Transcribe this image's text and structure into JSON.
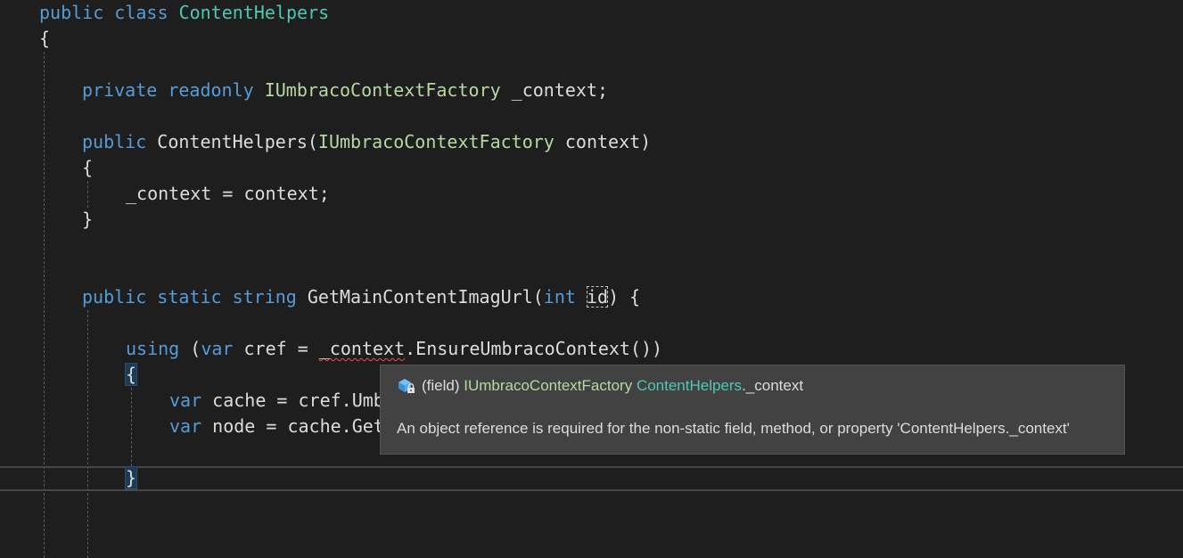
{
  "code": {
    "line1": {
      "kw1": "public",
      "kw2": "class",
      "type": "ContentHelpers"
    },
    "line2": {
      "brace": "{"
    },
    "line3": {
      "kw1": "private",
      "kw2": "readonly",
      "iface": "IUmbracoContextFactory",
      "rest": "_context;"
    },
    "line4": {
      "kw1": "public",
      "name": "ContentHelpers(",
      "iface": "IUmbracoContextFactory",
      "rest": "context)"
    },
    "line5": {
      "brace": "{"
    },
    "line6": {
      "text": "_context = context;"
    },
    "line7": {
      "brace": "}"
    },
    "line8": {
      "kw1": "public",
      "kw2": "static",
      "kw3": "string",
      "name": "GetMainContentImagUrl(",
      "kw4": "int",
      "param": "id",
      "rest": ") {"
    },
    "line9": {
      "kw1": "using",
      "open": "(",
      "kw2": "var",
      "mid": "cref =",
      "err": "_context",
      "rest": ".EnsureUmbracoContext())"
    },
    "line10": {
      "brace": "{"
    },
    "line11": {
      "kw": "var",
      "rest": "cache = cref.Umb"
    },
    "line12": {
      "kw": "var",
      "rest": "node = cache.Get"
    },
    "line13": {
      "brace": "}"
    }
  },
  "tooltip": {
    "icon": "field-lock-icon",
    "kind": "(field)",
    "iface": "IUmbracoContextFactory",
    "owner": "ContentHelpers",
    "member": "._context",
    "message": "An object reference is required for the non-static field, method, or property 'ContentHelpers._context'"
  },
  "colors": {
    "background": "#1e1e1e",
    "keyword": "#569cd6",
    "type": "#4ec9b0",
    "interface": "#b8d7a3",
    "text": "#dcdcdc",
    "tooltip_bg": "#424242",
    "error": "#f14c4c"
  }
}
